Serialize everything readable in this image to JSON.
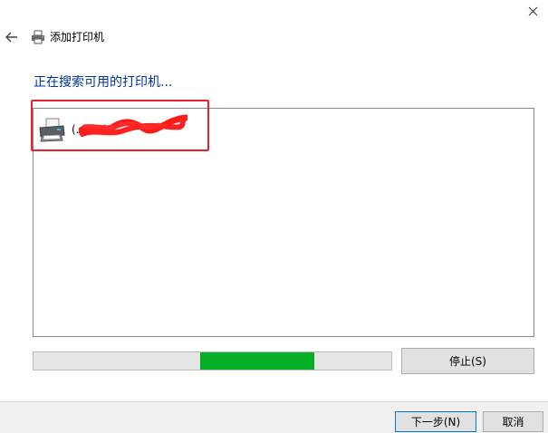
{
  "window": {
    "title": "添加打印机",
    "close_glyph": "✕",
    "back_glyph": "←"
  },
  "main": {
    "heading": "正在搜索可用的打印机...",
    "printers": [
      {
        "name_visible": "                  (...ON)",
        "icon": "printer-icon"
      }
    ],
    "search_progress": {
      "segment_start": 0.465,
      "segment_end": 0.785,
      "color": "#06b025"
    },
    "stop_label": "停止(S)"
  },
  "footer": {
    "next_label": "下一步(N)",
    "cancel_label": "取消"
  },
  "colors": {
    "heading": "#003399",
    "highlight": "#e8232d",
    "progress": "#06b025",
    "default_button_border": "#0078d7"
  }
}
